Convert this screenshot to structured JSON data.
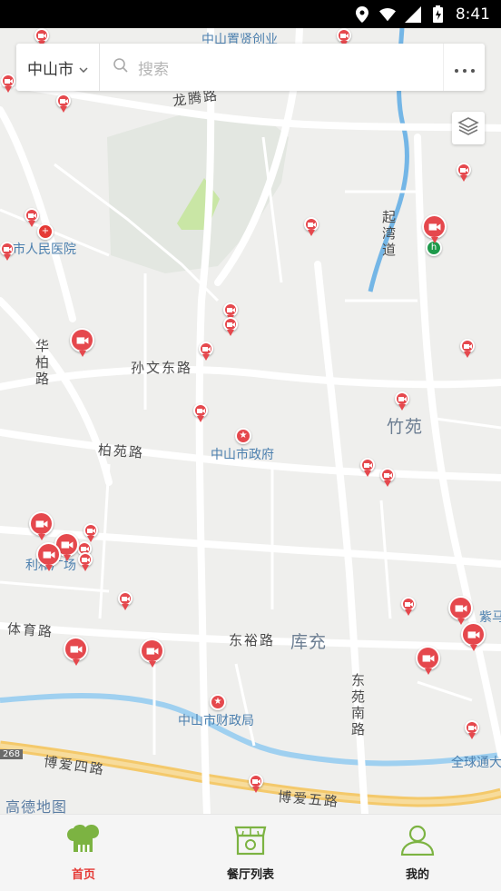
{
  "status_bar": {
    "time": "8:41"
  },
  "search": {
    "city": "中山市",
    "placeholder": "搜索"
  },
  "map": {
    "labels": {
      "longteng_road": "龙腾路",
      "zhongshan_zhixian": "中山置贤创业",
      "zhongshan_hospital": "山市人民医院",
      "huabai_road": "华柏路",
      "sunwen_east_road": "孙文东路",
      "qiwan_road": "起湾道",
      "zhuyuan": "竹苑",
      "zhongshan_gov": "中山市政府",
      "baiyuan_road": "柏苑路",
      "lihe_plaza": "利和广场",
      "tiyu_road": "体育路",
      "dongyu_road": "东裕路",
      "kuchong": "库充",
      "dongyuan_south_road": "东苑南路",
      "zhongshan_finance": "中山市财政局",
      "bo_ai_4_road": "博爱四路",
      "bo_ai_5_road": "博爱五路",
      "gaode_map": "高德地图",
      "zima": "紫马",
      "global_tong": "全球通大",
      "road_num": "268"
    }
  },
  "nav": {
    "home": "首页",
    "restaurant_list": "餐厅列表",
    "mine": "我的"
  },
  "colors": {
    "accent": "#e53935",
    "pin": "#e5484d",
    "icon_green": "#7cb342"
  }
}
